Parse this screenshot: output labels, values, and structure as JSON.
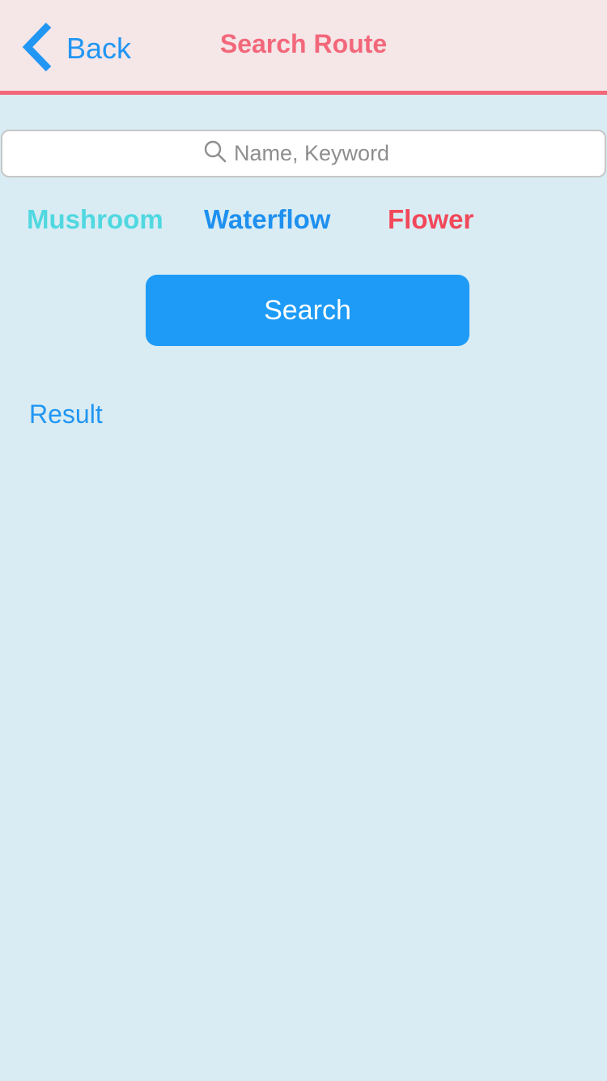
{
  "navbar": {
    "back_label": "Back",
    "title": "Search Route",
    "accent_color": "#f2687a",
    "back_icon": "chevron-left-icon"
  },
  "search": {
    "placeholder": "Name, Keyword",
    "value": "",
    "icon": "search-icon"
  },
  "categories": [
    {
      "label": "Mushroom",
      "color": "#50d8e0"
    },
    {
      "label": "Waterflow",
      "color": "#1e90f0"
    },
    {
      "label": "Flower",
      "color": "#f2485a"
    }
  ],
  "actions": {
    "search_button_label": "Search",
    "button_color": "#1e9bf7"
  },
  "results": {
    "label": "Result"
  },
  "colors": {
    "background": "#d9ecf3",
    "navbar_background": "#f5e6e8",
    "link": "#2196f3"
  }
}
